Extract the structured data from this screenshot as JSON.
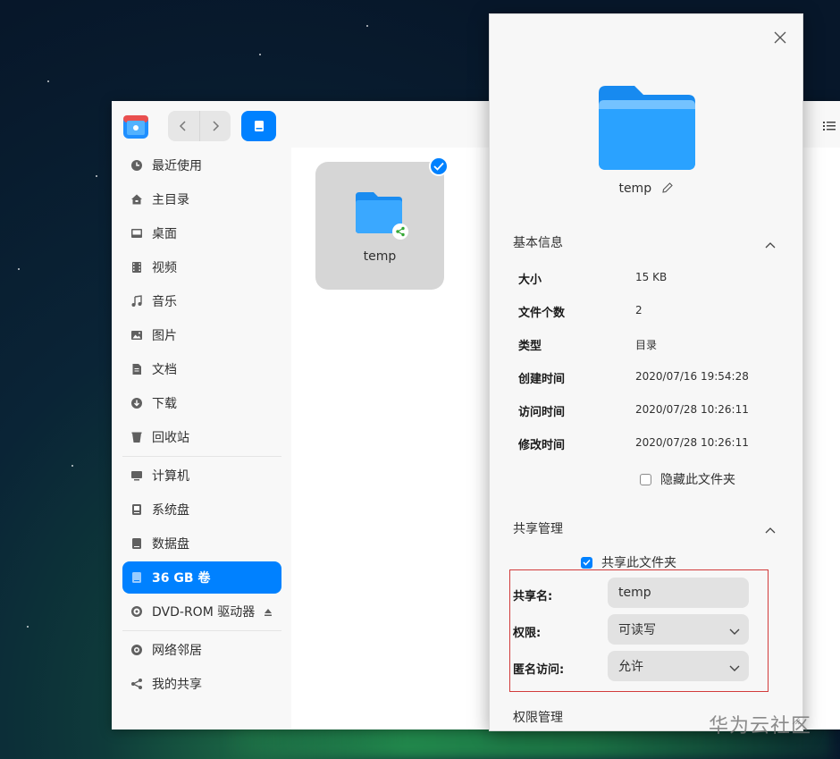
{
  "sidebar": {
    "items": [
      {
        "label": "最近使用",
        "icon": "clock-icon"
      },
      {
        "label": "主目录",
        "icon": "home-icon"
      },
      {
        "label": "桌面",
        "icon": "desktop-icon"
      },
      {
        "label": "视频",
        "icon": "video-icon"
      },
      {
        "label": "音乐",
        "icon": "music-icon"
      },
      {
        "label": "图片",
        "icon": "picture-icon"
      },
      {
        "label": "文档",
        "icon": "document-icon"
      },
      {
        "label": "下载",
        "icon": "download-icon"
      },
      {
        "label": "回收站",
        "icon": "trash-icon"
      }
    ],
    "devices": [
      {
        "label": "计算机",
        "icon": "computer-icon"
      },
      {
        "label": "系统盘",
        "icon": "system-disk-icon"
      },
      {
        "label": "数据盘",
        "icon": "data-disk-icon"
      },
      {
        "label": "36 GB 卷",
        "icon": "volume-icon",
        "active": true
      },
      {
        "label": "DVD-ROM 驱动器",
        "icon": "dvd-icon"
      }
    ],
    "network": [
      {
        "label": "网络邻居",
        "icon": "network-icon"
      },
      {
        "label": "我的共享",
        "icon": "share-icon"
      }
    ]
  },
  "content": {
    "file": {
      "name": "temp",
      "selected": true,
      "shared": true
    }
  },
  "properties": {
    "folder_name": "temp",
    "basic_info": {
      "title": "基本信息",
      "rows": [
        {
          "key": "大小",
          "value": "15 KB"
        },
        {
          "key": "文件个数",
          "value": "2"
        },
        {
          "key": "类型",
          "value": "目录"
        },
        {
          "key": "创建时间",
          "value": "2020/07/16 19:54:28"
        },
        {
          "key": "访问时间",
          "value": "2020/07/28 10:26:11"
        },
        {
          "key": "修改时间",
          "value": "2020/07/28 10:26:11"
        }
      ],
      "hide_folder_label": "隐藏此文件夹",
      "hide_folder_checked": false
    },
    "share": {
      "title": "共享管理",
      "share_folder_label": "共享此文件夹",
      "share_folder_checked": true,
      "share_name_label": "共享名:",
      "share_name_value": "temp",
      "permission_label": "权限:",
      "permission_value": "可读写",
      "anonymous_label": "匿名访问:",
      "anonymous_value": "允许"
    },
    "permissions": {
      "title": "权限管理"
    }
  },
  "watermark": "华为云社区",
  "colors": {
    "accent": "#0081ff",
    "highlight_border": "#d23b3b"
  }
}
